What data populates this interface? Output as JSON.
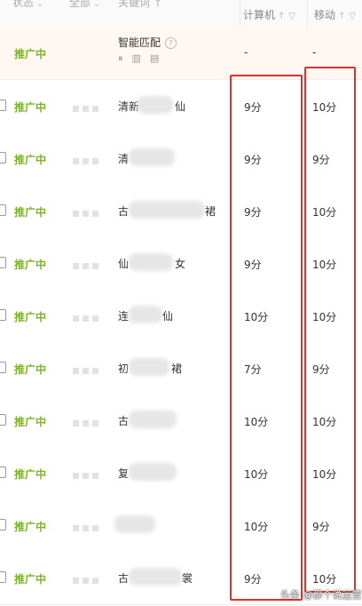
{
  "columns": {
    "status": "状态",
    "group": "全部",
    "keyword": "关键词 ↑",
    "pc": "计算机",
    "mobile": "移动"
  },
  "colors": {
    "status_green": "#7ab623",
    "highlight_red": "#d9342b",
    "pinned_bg": "#fff7f1"
  },
  "smart_row": {
    "status": "推广中",
    "label": "智能匹配",
    "icons": [
      "pause-icon",
      "bar-chart-icon",
      "clipboard-icon"
    ],
    "pc": "-",
    "mobile": "-"
  },
  "rows": [
    {
      "status": "推广中",
      "kw_prefix": "清新",
      "kw_suffix": "仙",
      "pc": "9分",
      "mobile": "10分"
    },
    {
      "status": "推广中",
      "kw_prefix": "清",
      "kw_suffix": "",
      "pc": "9分",
      "mobile": "9分"
    },
    {
      "status": "推广中",
      "kw_prefix": "古",
      "kw_suffix": "裙",
      "pc": "9分",
      "mobile": "10分"
    },
    {
      "status": "推广中",
      "kw_prefix": "仙",
      "kw_suffix": "女",
      "pc": "9分",
      "mobile": "10分"
    },
    {
      "status": "推广中",
      "kw_prefix": "连",
      "kw_suffix": "仙",
      "pc": "10分",
      "mobile": "10分"
    },
    {
      "status": "推广中",
      "kw_prefix": "初",
      "kw_suffix": "裙",
      "pc": "7分",
      "mobile": "9分"
    },
    {
      "status": "推广中",
      "kw_prefix": "古",
      "kw_suffix": "",
      "pc": "10分",
      "mobile": "10分"
    },
    {
      "status": "推广中",
      "kw_prefix": "复",
      "kw_suffix": "",
      "pc": "10分",
      "mobile": "10分"
    },
    {
      "status": "推广中",
      "kw_prefix": "",
      "kw_suffix": "",
      "pc": "10分",
      "mobile": "9分"
    },
    {
      "status": "推广中",
      "kw_prefix": "古",
      "kw_suffix": "裳",
      "pc": "9分",
      "mobile": "10分"
    }
  ],
  "watermark": "头条 @那个说运营"
}
